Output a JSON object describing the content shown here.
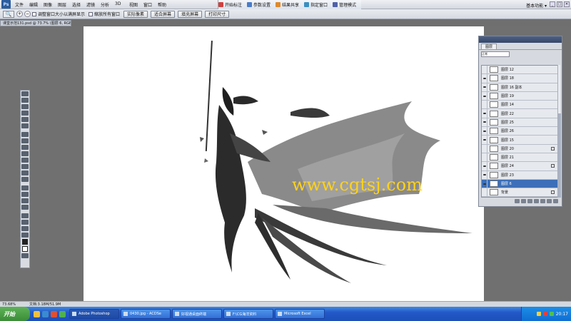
{
  "app": {
    "logo_text": "Ps",
    "menus": [
      "文件",
      "编辑",
      "图像",
      "图层",
      "选择",
      "滤镜",
      "分析",
      "3D",
      "视图",
      "窗口",
      "帮助"
    ],
    "workspace_label": "基本功能 ▾",
    "window_buttons": [
      "_",
      "□",
      "✕"
    ]
  },
  "ext_toolbar": {
    "items": [
      {
        "label": "开始标注",
        "color": "#d04040"
      },
      {
        "label": "参数设置",
        "color": "#4a7cc8"
      },
      {
        "label": "结果共享",
        "color": "#e08a2a"
      },
      {
        "label": "指定窗口",
        "color": "#3a90c0"
      },
      {
        "label": "管理模式",
        "color": "#5060a8"
      }
    ]
  },
  "options_bar": {
    "checkbox_resize": "调整窗口大小以满屏显示",
    "checkbox_zoom_all": "缩放所有窗口",
    "btn_actual": "实际像素",
    "btn_fit": "适合屏幕",
    "btn_fill": "填充屏幕",
    "btn_print": "打印尺寸"
  },
  "document": {
    "title": "课堂示范131.psd @ 73.7% (图层 6, RGB/8)",
    "watermark": "www.cgtsj.com"
  },
  "status": {
    "zoom": "73.68%",
    "doc_size": "文档:3.18M/51.9M"
  },
  "layers_panel": {
    "header": "图层",
    "tab": "图层",
    "blend_mode": "正常",
    "layers": [
      {
        "name": "图层 12",
        "visible": false,
        "locked": false,
        "selected": false
      },
      {
        "name": "图层 18",
        "visible": true,
        "locked": false,
        "selected": false
      },
      {
        "name": "图层 16 副本",
        "visible": true,
        "locked": false,
        "selected": false
      },
      {
        "name": "图层 19",
        "visible": true,
        "locked": false,
        "selected": false
      },
      {
        "name": "图层 14",
        "visible": false,
        "locked": false,
        "selected": false
      },
      {
        "name": "图层 22",
        "visible": true,
        "locked": false,
        "selected": false
      },
      {
        "name": "图层 25",
        "visible": true,
        "locked": false,
        "selected": false
      },
      {
        "name": "图层 26",
        "visible": true,
        "locked": false,
        "selected": false
      },
      {
        "name": "图层 15",
        "visible": true,
        "locked": false,
        "selected": false
      },
      {
        "name": "图层 20",
        "visible": false,
        "locked": true,
        "selected": false
      },
      {
        "name": "图层 21",
        "visible": false,
        "locked": false,
        "selected": false
      },
      {
        "name": "图层 24",
        "visible": true,
        "locked": true,
        "selected": false
      },
      {
        "name": "图层 23",
        "visible": true,
        "locked": false,
        "selected": false
      },
      {
        "name": "图层 6",
        "visible": true,
        "locked": false,
        "selected": true
      },
      {
        "name": "背景",
        "visible": false,
        "locked": true,
        "selected": false
      }
    ]
  },
  "taskbar": {
    "start_label": "开始",
    "quick_launch_colors": [
      "#f0c040",
      "#3a8ad0",
      "#e05030",
      "#50b050"
    ],
    "tasks": [
      {
        "label": "Adobe Photoshop",
        "active": true
      },
      {
        "label": "0430.jpg - ACDSe",
        "active": false
      },
      {
        "label": "好视通桌面终端",
        "active": false
      },
      {
        "label": "F:\\CG海洋资料",
        "active": false
      },
      {
        "label": "Microsoft Excel",
        "active": false
      }
    ],
    "clock": "20:17"
  }
}
